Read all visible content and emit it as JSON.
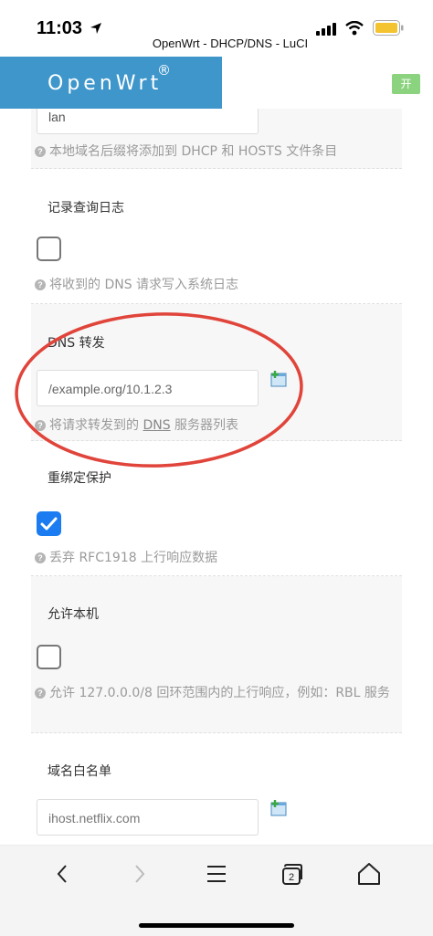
{
  "status_bar": {
    "time": "11:03",
    "icons": [
      "location-arrow-icon",
      "signal-icon",
      "wifi-icon",
      "battery-icon"
    ]
  },
  "browser": {
    "page_title": "OpenWrt - DHCP/DNS - LuCI"
  },
  "header": {
    "brand": "OpenWrt",
    "brand_mark": "®",
    "lang_badge": "开",
    "brand_color": "#3f96cb",
    "badge_color": "#8bd37f"
  },
  "form": {
    "local_suffix": {
      "value": "lan",
      "hint": "本地域名后缀将添加到 DHCP 和 HOSTS 文件条目"
    },
    "log_queries": {
      "label": "记录查询日志",
      "checked": false,
      "hint": "将收到的 DNS 请求写入系统日志"
    },
    "dns_forward": {
      "label": "DNS 转发",
      "placeholder": "/example.org/10.1.2.3",
      "hint_prefix": "将请求转发到的 ",
      "hint_link": "DNS",
      "hint_suffix": " 服务器列表"
    },
    "rebind_protection": {
      "label": "重绑定保护",
      "checked": true,
      "hint": "丢弃 RFC1918 上行响应数据"
    },
    "allow_localhost": {
      "label": "允许本机",
      "checked": false,
      "hint": "允许 127.0.0.0/8 回环范围内的上行响应，例如：RBL 服务"
    },
    "domain_whitelist": {
      "label": "域名白名单",
      "placeholder": "ihost.netflix.com"
    }
  },
  "annotation_color": "#e0443a",
  "toolbar": {
    "buttons": [
      "back-icon",
      "forward-icon",
      "menu-icon",
      "tabs-icon",
      "home-icon"
    ],
    "tabs_count": "2"
  }
}
